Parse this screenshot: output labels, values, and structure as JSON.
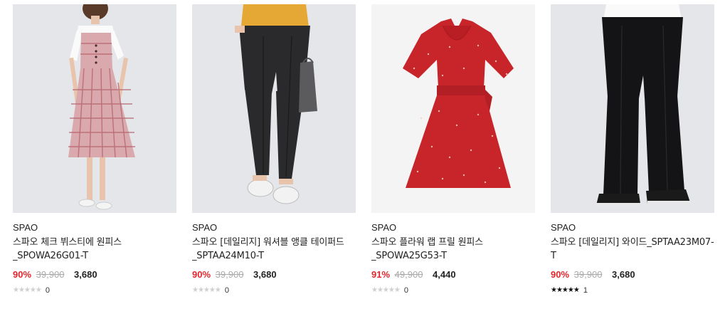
{
  "products": [
    {
      "brand": "SPAO",
      "title": "스파오 체크 뷔스티에 원피스 _SPOWA26G01-T",
      "discount": "90%",
      "original_price": "39,900",
      "sale_price": "3,680",
      "stars": "★★★★★",
      "rating_count": "0",
      "rating_filled": false,
      "image_icon": "checked-dress-photo",
      "colors": {
        "bg": "#e4e6ea",
        "garment": "#d9a9ad"
      }
    },
    {
      "brand": "SPAO",
      "title": "스파오 [데일리지] 워셔블 앵클 테이퍼드 _SPTAA24M10-T",
      "discount": "90%",
      "original_price": "39,900",
      "sale_price": "3,680",
      "stars": "★★★★★",
      "rating_count": "0",
      "rating_filled": false,
      "image_icon": "tapered-pants-photo",
      "colors": {
        "bg": "#e4e6ea",
        "garment": "#2a2a2c"
      }
    },
    {
      "brand": "SPAO",
      "title": "스파오 플라워 랩 프릴 원피스 _SPOWA25G53-T",
      "discount": "91%",
      "original_price": "49,900",
      "sale_price": "4,440",
      "stars": "★★★★★",
      "rating_count": "0",
      "rating_filled": false,
      "image_icon": "red-floral-dress-photo",
      "colors": {
        "bg": "#f4f4f4",
        "garment": "#c8252a"
      }
    },
    {
      "brand": "SPAO",
      "title": "스파오 [데일리지] 와이드_SPTAA23M07-T",
      "discount": "90%",
      "original_price": "39,900",
      "sale_price": "3,680",
      "stars": "★★★★★",
      "rating_count": "1",
      "rating_filled": true,
      "image_icon": "wide-pants-photo",
      "colors": {
        "bg": "#e4e6ea",
        "garment": "#141416"
      }
    }
  ]
}
